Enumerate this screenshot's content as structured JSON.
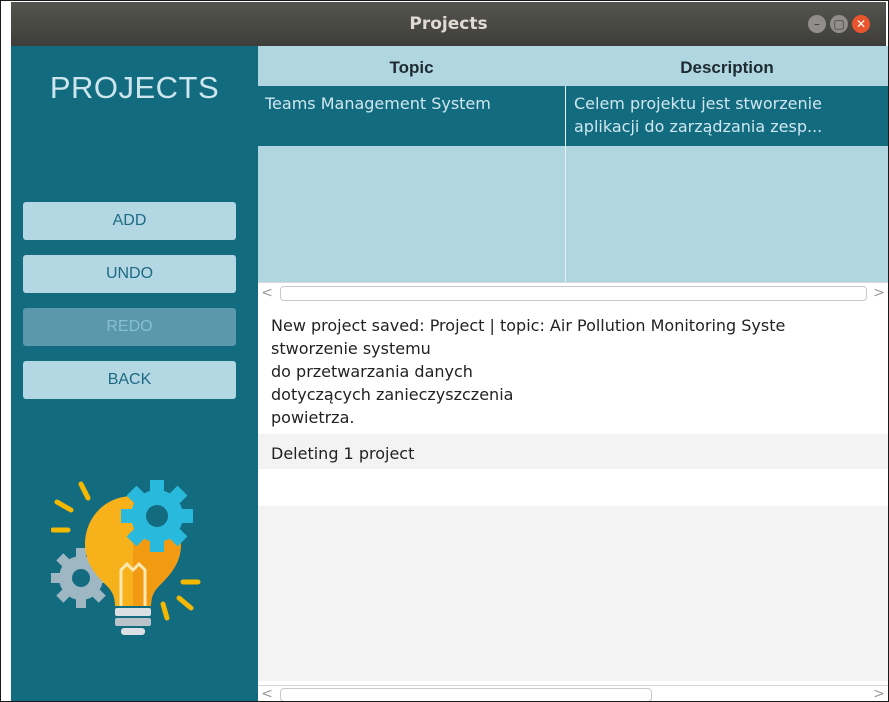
{
  "window": {
    "title": "Projects",
    "controls": {
      "minimize_icon": "–",
      "maximize_icon": "▢",
      "close_icon": "✕"
    }
  },
  "sidebar": {
    "heading": "PROJECTS",
    "buttons": [
      {
        "label": "ADD",
        "enabled": true
      },
      {
        "label": "UNDO",
        "enabled": true
      },
      {
        "label": "REDO",
        "enabled": false
      },
      {
        "label": "BACK",
        "enabled": true
      }
    ],
    "illustration": "lightbulb-gears-icon"
  },
  "table": {
    "columns": [
      "Topic",
      "Description"
    ],
    "rows": [
      {
        "topic": "Teams Management System",
        "description_line1": "Celem projektu jest stworzenie",
        "description_line2": "aplikacji do zarządzania zesp..."
      }
    ]
  },
  "log": {
    "entries": [
      {
        "lines": [
          "New project saved: Project | topic: Air Pollution Monitoring Syste",
          "stworzenie systemu",
          "do przetwarzania danych",
          "dotyczących zanieczyszczenia",
          "powietrza."
        ]
      },
      {
        "lines": [
          "Deleting 1 project"
        ]
      }
    ]
  },
  "scroll_arrows": {
    "left": "<",
    "right": ">"
  },
  "colors": {
    "sidebar_bg": "#136b80",
    "button_bg": "#b4d8e3",
    "button_text": "#1e6a84",
    "table_bg": "#b0d6e2",
    "selected_row": "#136b80",
    "titlebar_close": "#e9552d"
  }
}
